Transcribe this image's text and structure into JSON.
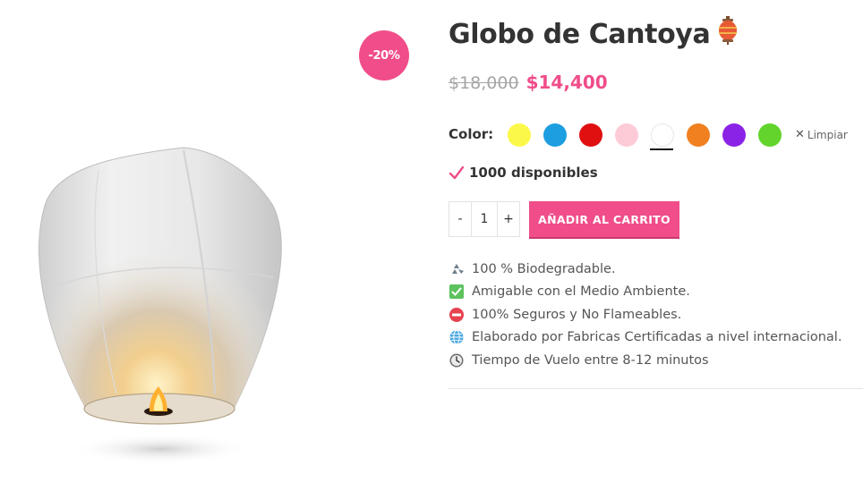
{
  "product": {
    "title": "Globo de Cantoya",
    "title_emoji": "🏮",
    "sale_badge": "-20%",
    "old_price": "$18,000",
    "new_price": "$14,400",
    "image_icon": "sky-lantern-image"
  },
  "variations": {
    "color_label": "Color",
    "colors": [
      {
        "name": "amarillo",
        "hex": "#fbf84a"
      },
      {
        "name": "azul",
        "hex": "#1c9ee0"
      },
      {
        "name": "rojo",
        "hex": "#e00f10"
      },
      {
        "name": "rosa",
        "hex": "#fdcbd8"
      },
      {
        "name": "blanco",
        "hex": "#ffffff"
      },
      {
        "name": "naranja",
        "hex": "#f08020"
      },
      {
        "name": "morado",
        "hex": "#8b23e6"
      },
      {
        "name": "verde",
        "hex": "#62d42c"
      }
    ],
    "selected": "blanco",
    "clear_label": "Limpiar"
  },
  "stock": {
    "text": "1000 disponibles",
    "icon": "check-icon"
  },
  "cart": {
    "qty_minus": "-",
    "qty_plus": "+",
    "quantity": "1",
    "add_to_cart_label": "AÑADIR AL CARRITO"
  },
  "features": [
    {
      "icon": "recycle-icon",
      "text": "100 % Biodegradable."
    },
    {
      "icon": "green-check-icon",
      "text": "Amigable con el Medio Ambiente."
    },
    {
      "icon": "no-entry-icon",
      "text": "100% Seguros y No Flameables."
    },
    {
      "icon": "globe-icon",
      "text": "Elaborado por Fabricas Certificadas a nivel internacional."
    },
    {
      "icon": "clock-icon",
      "text": "Tiempo de Vuelo entre 8-12 minutos"
    }
  ],
  "colors": {
    "accent": "#f04d8a",
    "old_price": "#a5a5a5",
    "text": "#333333"
  }
}
